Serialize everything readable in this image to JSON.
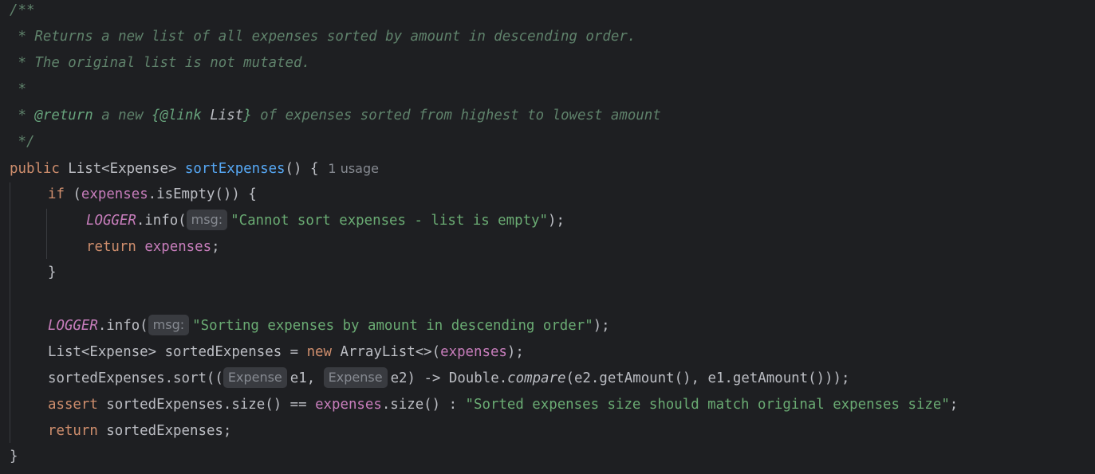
{
  "javadoc": {
    "open": "/**",
    "line1": " * Returns a new list of all expenses sorted by amount in descending order.",
    "line2": " * The original list is not mutated.",
    "line3": " *",
    "line4_prefix": " * ",
    "line4_tag": "@return",
    "line4_mid": " a new ",
    "line4_link_open": "{@link ",
    "line4_link_ref": "List",
    "line4_link_close": "}",
    "line4_rest": " of expenses sorted from highest to lowest amount",
    "close": " */"
  },
  "signature": {
    "kw_public": "public",
    "return_type": " List<Expense> ",
    "method_name": "sortExpenses",
    "params": "() {",
    "usage_hint": "1 usage"
  },
  "body": {
    "if_kw": "if",
    "if_open": " (",
    "if_field": "expenses",
    "if_rest": ".isEmpty()) {",
    "logger1_field": "LOGGER",
    "logger1_call": ".info(",
    "logger1_hint": "msg:",
    "logger1_str": "\"Cannot sort expenses - list is empty\"",
    "logger1_end": ");",
    "return1_kw": "return",
    "return1_field": "expenses",
    "return1_end": ";",
    "if_close": "}",
    "logger2_field": "LOGGER",
    "logger2_call": ".info(",
    "logger2_hint": "msg:",
    "logger2_str": "\"Sorting expenses by amount in descending order\"",
    "logger2_end": ");",
    "decl_type": "List<Expense> sortedExpenses = ",
    "decl_new": "new",
    "decl_ctor": " ArrayList<>(",
    "decl_field": "expenses",
    "decl_end": ");",
    "sort_call": "sortedExpenses.sort((",
    "sort_hint1": "Expense",
    "sort_p1": "e1, ",
    "sort_hint2": "Expense",
    "sort_p2": "e2) -> Double.",
    "sort_compare": "compare",
    "sort_rest": "(e2.getAmount(), e1.getAmount()));",
    "assert_kw": "assert",
    "assert_mid": " sortedExpenses.size() == ",
    "assert_field": "expenses",
    "assert_rest": ".size() : ",
    "assert_str": "\"Sorted expenses size should match original expenses size\"",
    "assert_end": ";",
    "return2_kw": "return",
    "return2_rest": " sortedExpenses;",
    "method_close": "}"
  },
  "colors": {
    "background": "#1e1f22",
    "comment": "#5f826b",
    "keyword": "#cf8e6d",
    "method_declaration": "#56a8f5",
    "field": "#c77dbb",
    "string": "#6aab73",
    "default_text": "#bcbec4",
    "inlay_hint_bg": "#393b40",
    "inlay_hint_text": "#868a91"
  }
}
